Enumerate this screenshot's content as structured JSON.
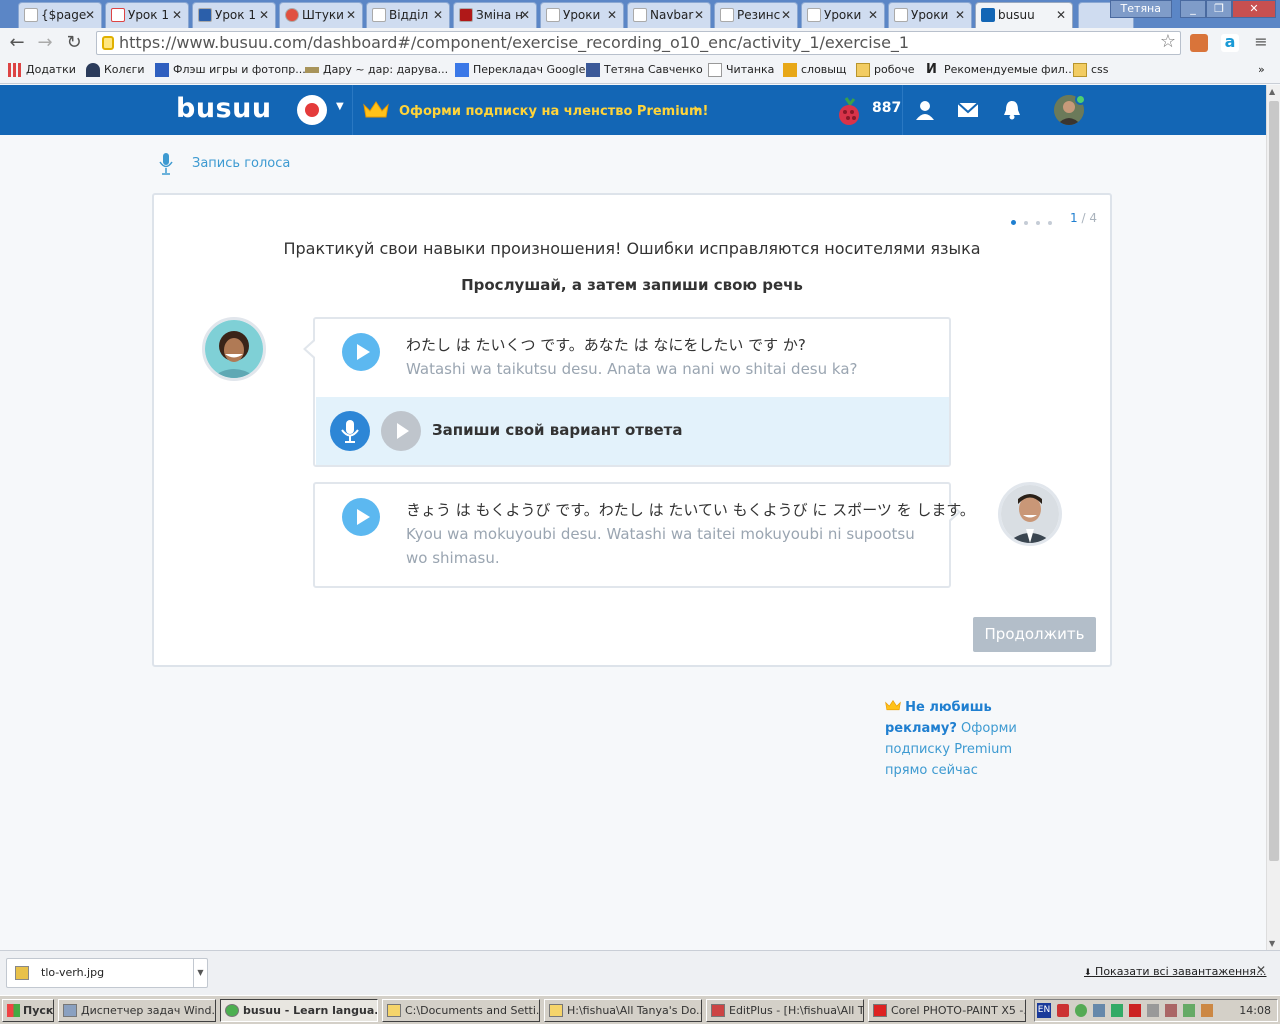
{
  "browser": {
    "tabs": [
      {
        "label": "{$page"
      },
      {
        "label": "Урок 1"
      },
      {
        "label": "Урок 1"
      },
      {
        "label": "Штуки"
      },
      {
        "label": "Відділ"
      },
      {
        "label": "Зміна н"
      },
      {
        "label": "Уроки"
      },
      {
        "label": "Navbar"
      },
      {
        "label": "Резинс"
      },
      {
        "label": "Уроки"
      },
      {
        "label": "Уроки"
      },
      {
        "label": "busuu"
      }
    ],
    "profile_name": "Тетяна",
    "url": "https://www.busuu.com/dashboard#/component/exercise_recording_o10_enc/activity_1/exercise_1",
    "bookmarks": [
      "Додатки",
      "Колєги",
      "Флэш игры и фотопр...",
      "Дару ~ дар: дарува...",
      "Перекладач Google",
      "Тетяна Савченко",
      "Читанка",
      "словыщ",
      "робоче",
      "Рекомендуемые фил...",
      "css"
    ]
  },
  "header": {
    "logo": "busuu",
    "premium_cta": "Оформи подписку на членство Premium!",
    "points": "887"
  },
  "exercise": {
    "breadcrumb": "Запись голоса",
    "pager_current": "1",
    "pager_total": "/ 4",
    "heading": "Практикуй свои навыки произношения! Ошибки исправляются носителями языка",
    "subheading": "Прослушай, а затем запиши свою речь",
    "line1_japanese": "わたし は たいくつ です。あなた は なにをしたい です か?",
    "line1_romaji": "Watashi wa taikutsu desu. Anata wa nani wo shitai desu ka?",
    "record_prompt": "Запиши свой вариант ответа",
    "line2_japanese": "きょう は もくようび です。わたし は たいてい もくようび に スポーツ を します。",
    "line2_romaji": "Kyou wa mokuyoubi desu. Watashi wa taitei mokuyoubi ni supootsu wo shimasu.",
    "continue_label": "Продолжить"
  },
  "ad": {
    "bold": "Не любишь рекламу?",
    "text": "Оформи подписку Premium прямо сейчас"
  },
  "downloads": {
    "file": "tlo-verh.jpg",
    "show_all": "Показати всі завантаження..."
  },
  "taskbar": {
    "start": "Пуск",
    "tasks": [
      "Диспетчер задач Wind...",
      "busuu - Learn langua...",
      "C:\\Documents and Setti...",
      "H:\\fishua\\All Tanya's Do...",
      "EditPlus - [H:\\fishua\\All T...",
      "Corel PHOTO-PAINT X5 -..."
    ],
    "lang": "EN",
    "clock": "14:08"
  },
  "colors": {
    "brand_blue": "#1366b5",
    "premium_yellow": "#ffd43a",
    "play_blue": "#5cb8f0",
    "record_bg": "#e3f2fb"
  }
}
